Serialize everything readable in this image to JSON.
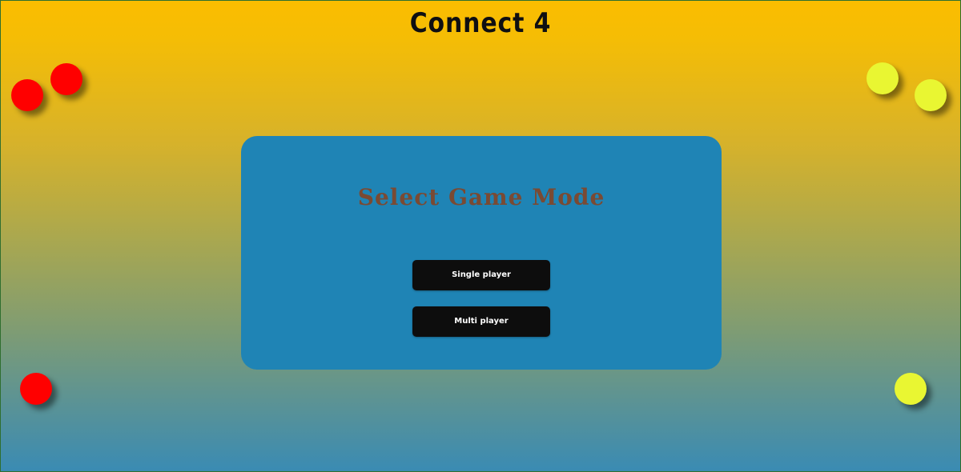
{
  "header": {
    "title": "Connect 4"
  },
  "menu": {
    "heading": "Select Game Mode",
    "buttons": {
      "single_label": "Single player",
      "multi_label": "Multi player"
    }
  },
  "decor": {
    "discs": [
      {
        "name": "red-disc",
        "color": "#ff0000"
      },
      {
        "name": "yellow-disc",
        "color": "#e9f632"
      }
    ]
  },
  "colors": {
    "gradient_top": "#fbbd00",
    "gradient_bottom": "#3a8bb3",
    "panel": "#1f84b5",
    "heading_text": "#7a4a33",
    "button_bg": "#0d0d0d",
    "button_text": "#ffffff"
  }
}
